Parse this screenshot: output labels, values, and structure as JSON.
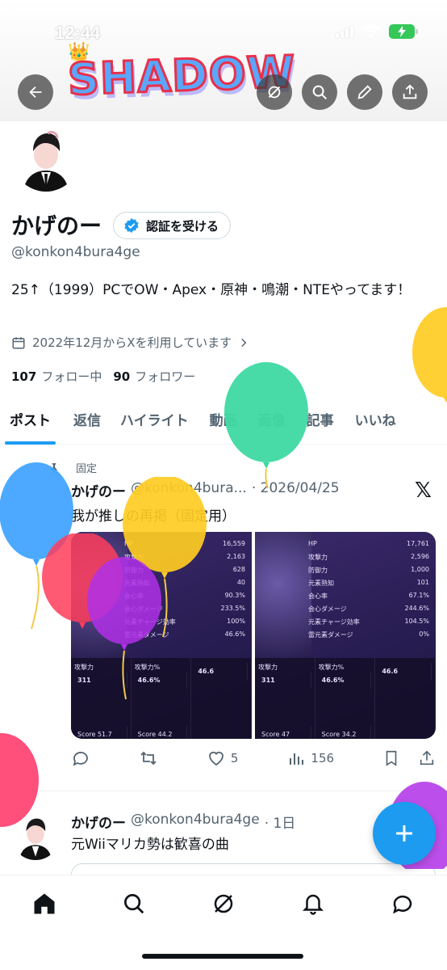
{
  "status_bar": {
    "time": "12:44"
  },
  "banner": {
    "logo_text": "SHADOW",
    "crown": "👑",
    "emoji": "😳"
  },
  "profile": {
    "name": "かげのー",
    "verify_label": "認証を受ける",
    "handle": "@konkon4bura4ge",
    "bio": "25↑（1999）PCでOW・Apex・原神・鳴潮・NTEやってます！",
    "joined": "2022年12月からXを利用しています",
    "following_count": "107",
    "following_label": "フォロー中",
    "followers_count": "90",
    "followers_label": "フォロワー"
  },
  "tabs": [
    {
      "label": "ポスト",
      "active": true
    },
    {
      "label": "返信"
    },
    {
      "label": "ハイライト"
    },
    {
      "label": "動画"
    },
    {
      "label": "画像"
    },
    {
      "label": "記事"
    },
    {
      "label": "いいね"
    }
  ],
  "pinned_post": {
    "pinned_label": "固定",
    "author": "かげのー",
    "handle": "@konkon4bura...",
    "date": "· 2026/04/25",
    "text": "我が推しの再掲（固定用）",
    "replies": "",
    "reposts": "",
    "likes": "5",
    "views": "156",
    "card_left": {
      "stats": [
        [
          "HP",
          "16,559"
        ],
        [
          "攻撃力",
          "2,163"
        ],
        [
          "防御力",
          "628"
        ],
        [
          "元素熟知",
          "40"
        ],
        [
          "会心率",
          "90.3%"
        ],
        [
          "会心ダメージ",
          "233.5%"
        ],
        [
          "元素チャージ効率",
          "100%"
        ],
        [
          "雷元素ダメージ",
          "46.6%"
        ]
      ],
      "bottom": [
        [
          "攻撃力",
          "311"
        ],
        [
          "攻撃力%",
          "46.6%"
        ],
        [
          "",
          "46.6"
        ]
      ],
      "scores": [
        "Score 51.7",
        "Score 44.2"
      ]
    },
    "card_right": {
      "stats": [
        [
          "HP",
          "17,761"
        ],
        [
          "攻撃力",
          "2,596"
        ],
        [
          "防御力",
          "1,000"
        ],
        [
          "元素熟知",
          "101"
        ],
        [
          "会心率",
          "67.1%"
        ],
        [
          "会心ダメージ",
          "244.6%"
        ],
        [
          "元素チャージ効率",
          "104.5%"
        ],
        [
          "雷元素ダメージ",
          "0%"
        ]
      ],
      "bottom": [
        [
          "攻撃力",
          "311"
        ],
        [
          "攻撃力%",
          "46.6%"
        ],
        [
          "",
          "46.6"
        ]
      ],
      "scores": [
        "Score 47",
        "Score 34.2"
      ]
    }
  },
  "second_post": {
    "author": "かげのー",
    "handle": "@konkon4bura4ge",
    "time": "· 1日",
    "text": "元Wiiマリカ勢は歓喜の曲"
  },
  "colors": {
    "accent": "#1d9bf0",
    "text": "#0f1419",
    "muted": "#536471"
  }
}
